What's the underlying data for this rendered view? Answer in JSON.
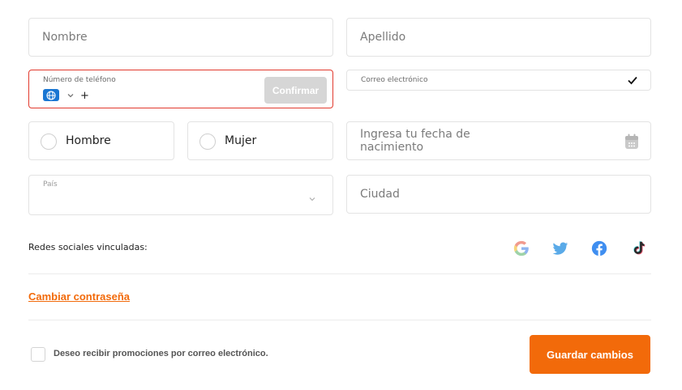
{
  "form": {
    "first_name": {
      "placeholder": "Nombre"
    },
    "last_name": {
      "placeholder": "Apellido"
    },
    "phone": {
      "label": "Número de teléfono",
      "prefix": "+",
      "confirm_label": "Confirmar",
      "state": "error",
      "border_color": "#e23a2e"
    },
    "email": {
      "label": "Correo electrónico",
      "verified": true
    },
    "gender": {
      "options": [
        {
          "label": "Hombre",
          "selected": false
        },
        {
          "label": "Mujer",
          "selected": false
        }
      ]
    },
    "birthdate": {
      "placeholder": "Ingresa tu fecha de nacimiento"
    },
    "country": {
      "label": "País",
      "value": ""
    },
    "city": {
      "placeholder": "Ciudad"
    }
  },
  "social": {
    "label": "Redes sociales vinculadas:",
    "icons": [
      "google-icon",
      "twitter-icon",
      "facebook-icon",
      "tiktok-icon"
    ]
  },
  "change_password_label": "Cambiar contraseña",
  "promotions": {
    "label": "Deseo recibir promociones por correo electrónico.",
    "checked": false
  },
  "save_label": "Guardar cambios",
  "colors": {
    "accent": "#f26a0a",
    "error": "#e23a2e",
    "disabled_button": "#d6d6d6",
    "globe": "#1976d2"
  }
}
